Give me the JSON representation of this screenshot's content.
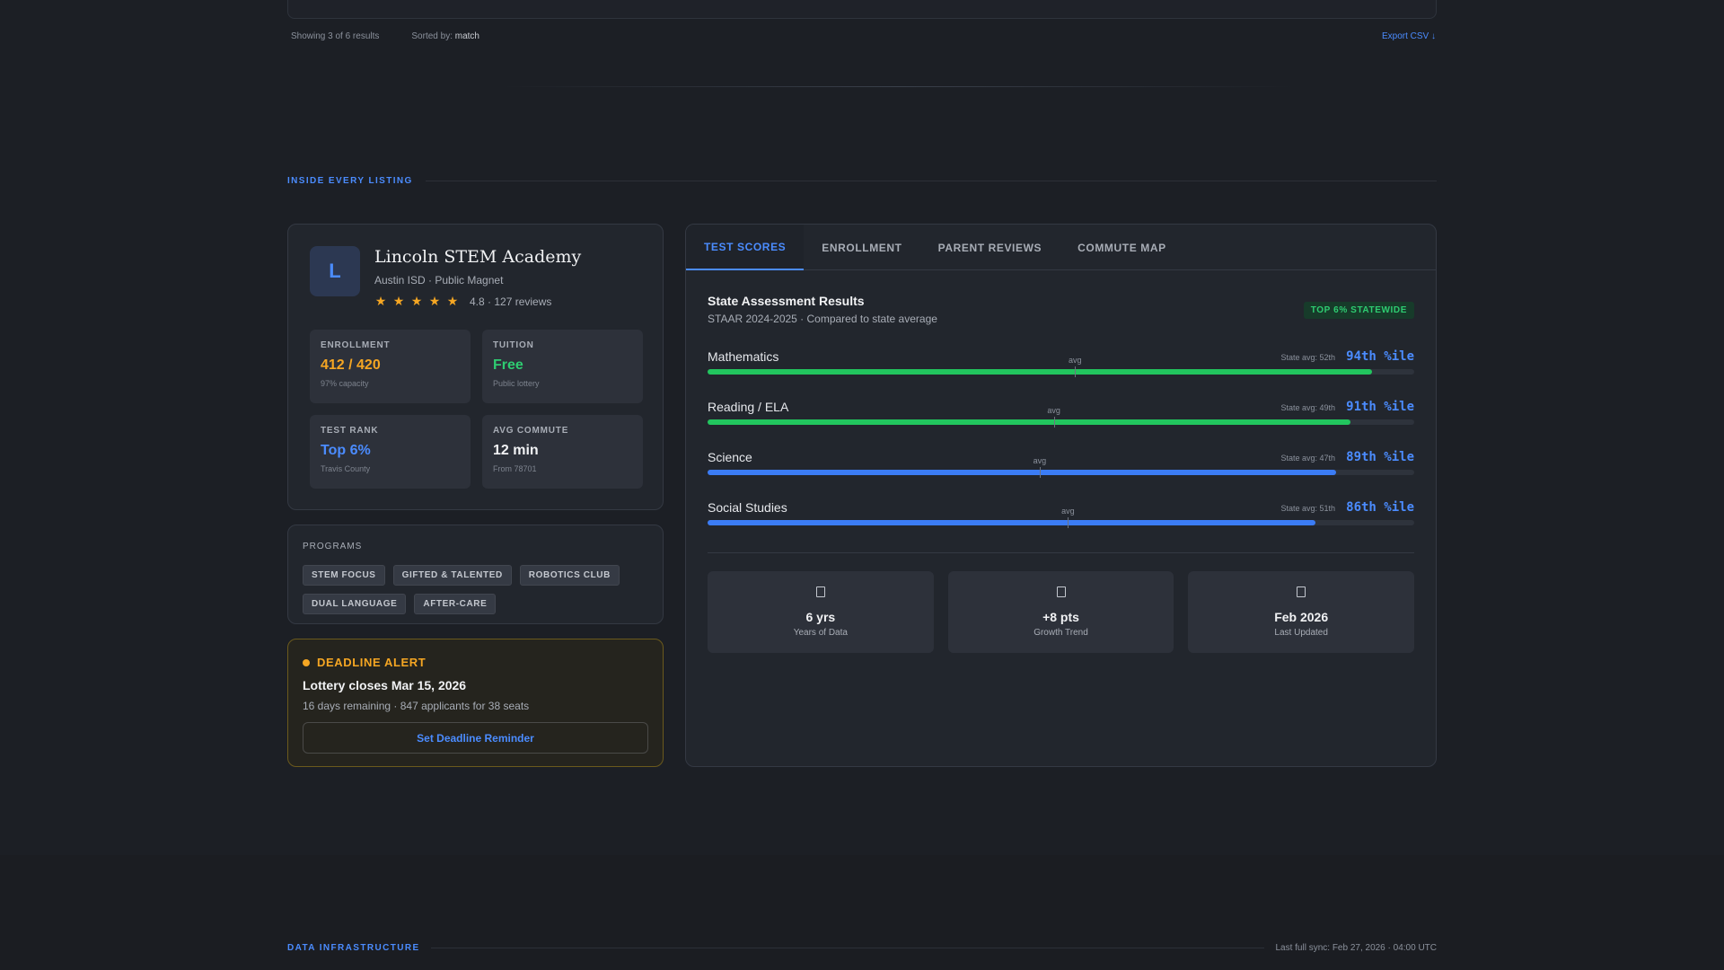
{
  "results": {
    "showing": "Showing 3 of 6 results",
    "sorted_prefix": "Sorted by:",
    "sorted_value": "match",
    "export_label": "Export CSV ↓"
  },
  "section_inside": {
    "label": "INSIDE EVERY LISTING"
  },
  "school": {
    "logo_letter": "L",
    "name": "Lincoln STEM Academy",
    "subtitle": "Austin ISD · Public Magnet",
    "stars": 5,
    "rating_text": "4.8 · 127 reviews",
    "stats": [
      {
        "label": "ENROLLMENT",
        "value": "412 / 420",
        "note": "97% capacity",
        "color": "#f5a623"
      },
      {
        "label": "TUITION",
        "value": "Free",
        "note": "Public lottery",
        "color": "#2ecc71"
      },
      {
        "label": "TEST RANK",
        "value": "Top 6%",
        "note": "Travis County",
        "color": "#4b8cff"
      },
      {
        "label": "AVG COMMUTE",
        "value": "12 min",
        "note": "From 78701",
        "color": "#f1f2f4"
      }
    ]
  },
  "programs": {
    "title": "PROGRAMS",
    "chips": [
      "STEM FOCUS",
      "GIFTED & TALENTED",
      "ROBOTICS CLUB",
      "DUAL LANGUAGE",
      "AFTER-CARE"
    ]
  },
  "deadline": {
    "title": "DEADLINE ALERT",
    "main": "Lottery closes Mar 15, 2026",
    "sub": "16 days remaining · 847 applicants for 38 seats",
    "button": "Set Deadline Reminder"
  },
  "tabs": [
    "TEST SCORES",
    "ENROLLMENT",
    "PARENT REVIEWS",
    "COMMUTE MAP"
  ],
  "assessment": {
    "title": "State Assessment Results",
    "subtitle": "STAAR 2024-2025 · Compared to state average",
    "badge": "TOP 6% STATEWIDE",
    "avg_label": "avg",
    "subjects": [
      {
        "name": "Mathematics",
        "state_avg": "State avg: 52th",
        "avg_value": 52,
        "percentile": "94th %ile",
        "value": 94,
        "color": "#22c55e"
      },
      {
        "name": "Reading / ELA",
        "state_avg": "State avg: 49th",
        "avg_value": 49,
        "percentile": "91th %ile",
        "value": 91,
        "color": "#22c55e"
      },
      {
        "name": "Science",
        "state_avg": "State avg: 47th",
        "avg_value": 47,
        "percentile": "89th %ile",
        "value": 89,
        "color": "#3b7cf5"
      },
      {
        "name": "Social Studies",
        "state_avg": "State avg: 51th",
        "avg_value": 51,
        "percentile": "86th %ile",
        "value": 86,
        "color": "#3b7cf5"
      }
    ],
    "summary": [
      {
        "icon": "document-icon",
        "value": "6 yrs",
        "label": "Years of Data"
      },
      {
        "icon": "document-icon",
        "value": "+8 pts",
        "label": "Growth Trend"
      },
      {
        "icon": "document-icon",
        "value": "Feb 2026",
        "label": "Last Updated"
      }
    ]
  },
  "section_data": {
    "label": "DATA INFRASTRUCTURE",
    "sync": "Last full sync: Feb 27, 2026 · 04:00 UTC"
  }
}
